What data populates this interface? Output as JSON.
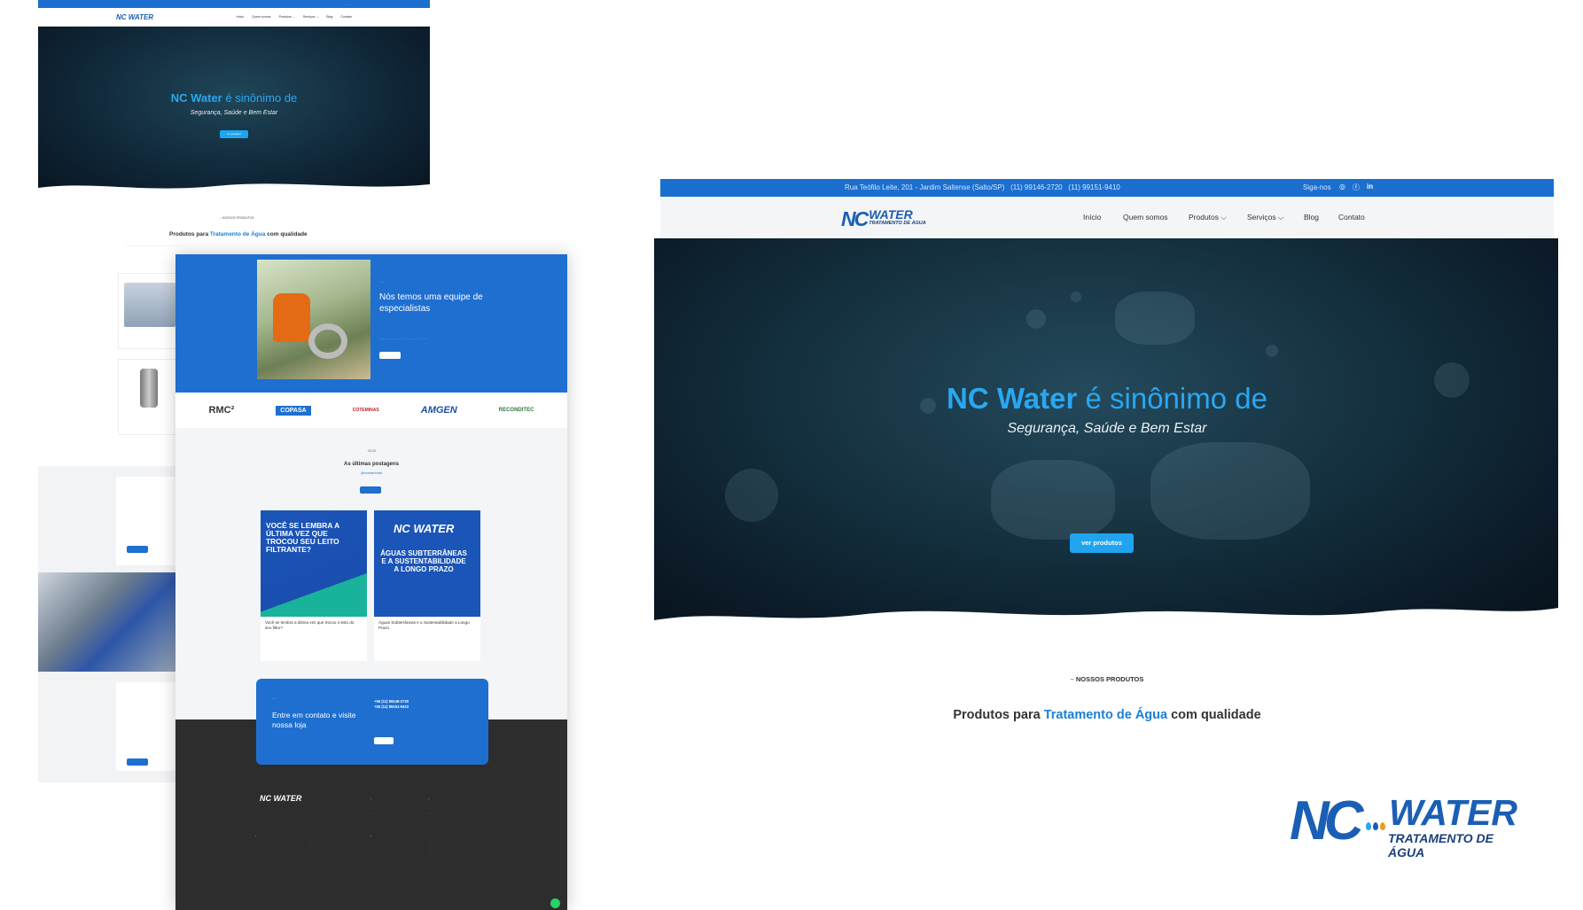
{
  "main": {
    "topbar": {
      "address": "Rua Teófilo Leite, 201 - Jardim Saltense (Salto/SP)",
      "phone1": "(11) 99146-2720",
      "phone2": "(11) 99151-9410",
      "follow": "Siga-nos"
    },
    "logo": {
      "mark": "NC",
      "word": "WATER",
      "sub": "TRATAMENTO DE ÁGUA"
    },
    "menu": [
      {
        "label": "Início"
      },
      {
        "label": "Quem somos"
      },
      {
        "label": "Produtos ⌵"
      },
      {
        "label": "Serviços ⌵"
      },
      {
        "label": "Blog"
      },
      {
        "label": "Contato"
      }
    ],
    "hero": {
      "title_strong": "NC Water",
      "title_rest": " é sinônimo de",
      "subtitle": "Segurança, Saúde e Bem Estar",
      "button": "ver produtos"
    },
    "products": {
      "tag_dash": "–",
      "tag": " NOSSOS PRODUTOS",
      "title_a": "Produtos para ",
      "title_hl": "Tratamento de Água",
      "title_b": " com qualidade"
    }
  },
  "preview_small": {
    "title_strong": "NC Water",
    "title_rest": " é sinônimo de",
    "subtitle": "Segurança, Saúde e Bem Estar",
    "products_tag": "– NOSSOS PRODUTOS",
    "products_title_a": "Produtos para ",
    "products_title_hl": "Tratamento de Água",
    "products_title_b": " com qualidade"
  },
  "preview_front": {
    "team_title": "Nós temos uma equipe de especialistas",
    "partners": [
      "RMC²",
      "COPASA",
      "COTEMINAS",
      "AMGEN",
      "RECONDITEC"
    ],
    "blog_title": "As últimas postagens",
    "blog_handle": "@ncwaterbrasil",
    "post1_title": "Você se lembra a última vez que trocou seu leito filtrante?",
    "post1_caption": "Você se lembra a última vez que trocou o leito do seu filtro?",
    "post2_title": "Águas subterrâneas e a sustentabilidade a longo prazo",
    "post2_caption": "Águas Subterrâneas e a Sustentabilidade a Longo Prazo",
    "contact_title": "Entre em contato e visite nossa loja",
    "contact_phone1": "+55 (11) 99146-2720",
    "contact_phone2": "+55 (11) 99151-9410",
    "footer_logo": "NC WATER"
  },
  "colors": {
    "brand_blue": "#1a6fcf",
    "accent_cyan": "#2aa7f0",
    "hero_dark": "#0b1a26",
    "footer": "#2d2d2d"
  }
}
